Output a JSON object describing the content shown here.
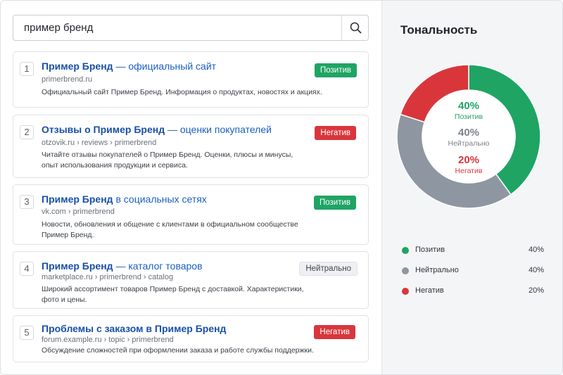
{
  "search": {
    "value": "пример бренд",
    "button_icon": "search-icon"
  },
  "results": [
    {
      "num": "1",
      "title_brand": "Пример Бренд",
      "title_rest": " — официальный сайт",
      "url": "primerbrend.ru",
      "desc": "Официальный сайт Пример Бренд. Информация о продуктах, новостях и акциях.",
      "badge": "Позитив",
      "sentiment": "positive"
    },
    {
      "num": "2",
      "title_brand": "Отзывы о Пример Бренд",
      "title_rest": " — оценки покупателей",
      "url": "otzovik.ru › reviews › primerbrend",
      "desc": "Читайте отзывы покупателей о Пример Бренд. Оценки, плюсы и минусы, опыт использования продукции и сервиса.",
      "badge": "Негатив",
      "sentiment": "negative"
    },
    {
      "num": "3",
      "title_brand": "Пример Бренд",
      "title_rest": " в социальных сетях",
      "url": "vk.com › primerbrend",
      "desc": "Новости, обновления и общение с клиентами в официальном сообществе Пример Бренд.",
      "badge": "Позитив",
      "sentiment": "positive"
    },
    {
      "num": "4",
      "title_brand": "Пример Бренд",
      "title_rest": " — каталог товаров",
      "url": "marketplace.ru › primerbrend › catalog",
      "desc": "Широкий ассортимент товаров Пример Бренд с доставкой. Характеристики, фото и цены.",
      "badge": "Нейтрально",
      "sentiment": "neutral"
    },
    {
      "num": "5",
      "title_brand": "Проблемы с заказом в Пример Бренд",
      "title_rest": "",
      "url": "forum.example.ru › topic › primerbrend",
      "desc": "Обсуждение сложностей при оформлении заказа и работе службы поддержки.",
      "badge": "Негатив",
      "sentiment": "negative"
    }
  ],
  "sentiment_panel": {
    "heading": "Тональность",
    "center": [
      {
        "pct": "40%",
        "label": "Позитив"
      },
      {
        "pct": "40%",
        "label": "Нейтрально"
      },
      {
        "pct": "20%",
        "label": "Негатив"
      }
    ],
    "legend": [
      {
        "name": "Позитив",
        "value": "40%"
      },
      {
        "name": "Нейтрально",
        "value": "40%"
      },
      {
        "name": "Негатив",
        "value": "20%"
      }
    ]
  },
  "colors": {
    "positive": "#1fa464",
    "neutral": "#8e96a1",
    "negative": "#d9363c",
    "link": "#1a5fc1"
  },
  "chart_data": {
    "type": "pie",
    "categories": [
      "Позитив",
      "Нейтрально",
      "Негатив"
    ],
    "values": [
      40,
      40,
      20
    ],
    "title": "Тональность"
  }
}
